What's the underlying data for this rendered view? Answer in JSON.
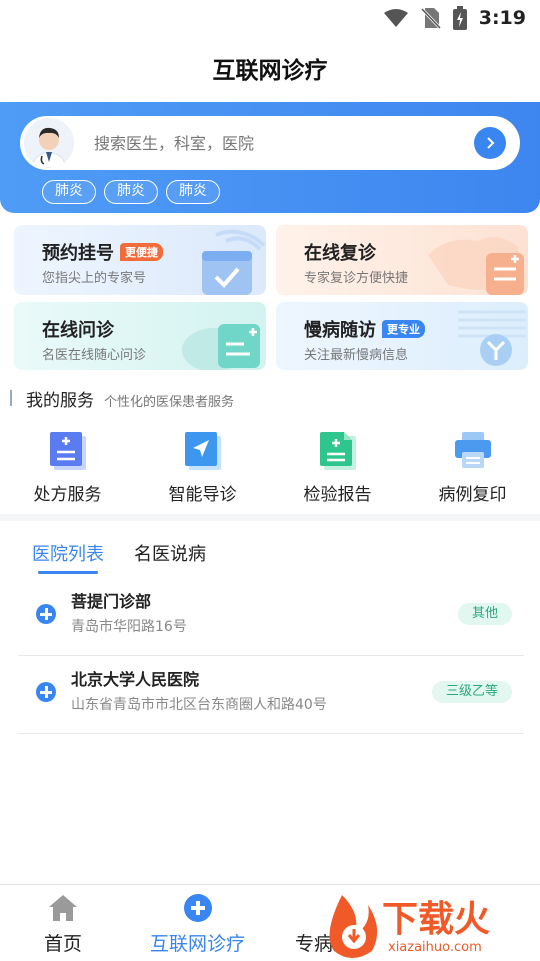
{
  "status": {
    "time": "3:19"
  },
  "header": {
    "title": "互联网诊疗"
  },
  "search": {
    "placeholder": "搜索医生，科室，医院",
    "tags": [
      "肺炎",
      "肺炎",
      "肺炎"
    ]
  },
  "cards": [
    {
      "title": "预约挂号",
      "badge": "更便捷",
      "subtitle": "您指尖上的专家号"
    },
    {
      "title": "在线复诊",
      "badge": "",
      "subtitle": "专家复诊方便快捷"
    },
    {
      "title": "在线问诊",
      "badge": "",
      "subtitle": "名医在线随心问诊"
    },
    {
      "title": "慢病随访",
      "badge": "更专业",
      "subtitle": "关注最新慢病信息"
    }
  ],
  "services": {
    "title": "我的服务",
    "subtitle": "个性化的医保患者服务",
    "items": [
      {
        "label": "处方服务",
        "icon": "prescription-icon"
      },
      {
        "label": "智能导诊",
        "icon": "navigation-icon"
      },
      {
        "label": "检验报告",
        "icon": "report-icon"
      },
      {
        "label": "病例复印",
        "icon": "printer-icon"
      }
    ]
  },
  "tabs": [
    {
      "label": "医院列表",
      "active": true
    },
    {
      "label": "名医说病",
      "active": false
    }
  ],
  "hospitals": [
    {
      "name": "菩提门诊部",
      "address": "青岛市华阳路16号",
      "level": "其他"
    },
    {
      "name": "北京大学人民医院",
      "address": "山东省青岛市市北区台东商圈人和路40号",
      "level": "三级乙等"
    }
  ],
  "bottom_nav": [
    {
      "label": "首页",
      "icon": "home-icon"
    },
    {
      "label": "互联网诊疗",
      "icon": "plus-circle-icon"
    },
    {
      "label": "专病...",
      "icon": ""
    }
  ],
  "watermark": {
    "brand": "下载火",
    "url": "xiazaihuo.com"
  },
  "colors": {
    "accent": "#3a86f0",
    "level_bg": "#e2f7f0",
    "level_text": "#2aa77f"
  }
}
